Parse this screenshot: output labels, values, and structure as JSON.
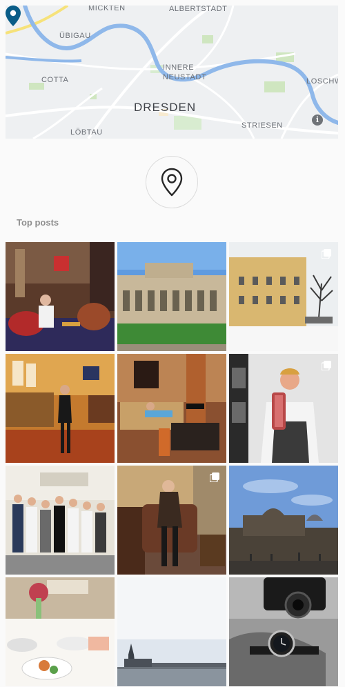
{
  "map": {
    "labels": {
      "mickten": "MICKTEN",
      "albertstadt": "ALBERTSTADT",
      "uebigau": "ÜBIGAU",
      "innere": "INNERE",
      "neustadt": "NEUSTADT",
      "cotta": "COTTA",
      "loschwitz": "LOSCHW",
      "city": "DRESDEN",
      "striesen": "STRIESEN",
      "loebtau": "LÖBTAU"
    },
    "info_label": "i",
    "pin_color": "#0a5d88",
    "river_color": "#8fb8ea"
  },
  "section": {
    "title": "Top posts"
  },
  "posts": [
    {
      "subject": "hotel bar lounge",
      "multi": false
    },
    {
      "subject": "zwinger palace",
      "multi": false
    },
    {
      "subject": "snowy hotel street",
      "multi": true
    },
    {
      "subject": "woman in restaurant",
      "multi": false
    },
    {
      "subject": "woman in hotel suite",
      "multi": false
    },
    {
      "subject": "chef with meat",
      "multi": true
    },
    {
      "subject": "hotel staff group",
      "multi": false
    },
    {
      "subject": "woman in armchair",
      "multi": true
    },
    {
      "subject": "dresden skyline",
      "multi": false
    },
    {
      "subject": "breakfast table",
      "multi": false
    },
    {
      "subject": "river panorama",
      "multi": false
    },
    {
      "subject": "camera and watch",
      "multi": false
    }
  ]
}
